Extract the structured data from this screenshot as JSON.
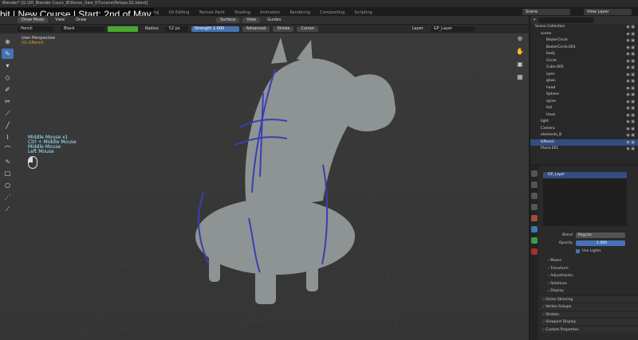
{
  "window": {
    "title": "Blender* [G:\\00_Blender Cours_IE\\Horse_Uwe_07\\scene\\Pelopo.02.blend]",
    "overlay_title": "bit | New Course | Start: 2nd of May"
  },
  "workspace_tabs": [
    "Sculpting",
    "UV Editing",
    "Texture Paint",
    "Shading",
    "Animation",
    "Rendering",
    "Compositing",
    "Scripting"
  ],
  "scene": {
    "name": "Scene",
    "view_layer": "View Layer"
  },
  "header": {
    "mode": "Draw Mode",
    "menus": [
      "View",
      "Draw"
    ],
    "placement": "Surface",
    "view_btn": "View",
    "guides": "Guides"
  },
  "tool_settings": {
    "brush": "Pencil",
    "material": "Black",
    "color_hex": "#4aa832",
    "radius_label": "Radius",
    "radius_value": "52 px",
    "strength_label": "Strength",
    "strength_value": "1.000",
    "advanced": "Advanced",
    "stroke": "Stroke",
    "cursor": "Cursor",
    "layer_label": "Layer",
    "layer_value": "GP_Layer"
  },
  "viewport": {
    "perspective": "User Perspective",
    "object_info": "(0) GPencil",
    "mouse_hints": [
      "Middle Mouse x1",
      "Ctrl + Middle Mouse",
      "Middle Mouse",
      "Left Mouse"
    ]
  },
  "toolbar_icons": [
    "cursor-icon",
    "pencil-icon",
    "fill-icon",
    "erase-icon",
    "tint-icon",
    "cutter-icon",
    "eyedropper-icon",
    "line-icon",
    "polyline-icon",
    "arc-icon",
    "curve-icon",
    "box-icon",
    "circle-icon",
    "interpolate-icon",
    "measure-icon"
  ],
  "outliner": {
    "title": "Scene Collection",
    "rows": [
      {
        "name": "Scene Collection",
        "indent": 0,
        "selected": false
      },
      {
        "name": "scene",
        "indent": 1,
        "selected": false
      },
      {
        "name": "BezierCircle",
        "indent": 2,
        "selected": false
      },
      {
        "name": "BezierCircle.001",
        "indent": 2,
        "selected": false
      },
      {
        "name": "body",
        "indent": 2,
        "selected": false
      },
      {
        "name": "Circle",
        "indent": 2,
        "selected": false
      },
      {
        "name": "Cube.005",
        "indent": 2,
        "selected": false
      },
      {
        "name": "eyes",
        "indent": 2,
        "selected": false
      },
      {
        "name": "glass",
        "indent": 2,
        "selected": false
      },
      {
        "name": "head",
        "indent": 2,
        "selected": false
      },
      {
        "name": "Sphere",
        "indent": 2,
        "selected": false
      },
      {
        "name": "spine",
        "indent": 2,
        "selected": false
      },
      {
        "name": "tail",
        "indent": 2,
        "selected": false
      },
      {
        "name": "trees",
        "indent": 2,
        "selected": false
      },
      {
        "name": "light",
        "indent": 1,
        "selected": false
      },
      {
        "name": "Camera",
        "indent": 1,
        "selected": false
      },
      {
        "name": "elements_B",
        "indent": 1,
        "selected": false
      },
      {
        "name": "GPencil",
        "indent": 1,
        "selected": true
      },
      {
        "name": "Plane.001",
        "indent": 1,
        "selected": false
      }
    ]
  },
  "properties": {
    "layer_name": "GP_Layer",
    "blend_label": "Blend",
    "blend_value": "Regular",
    "opacity_label": "Opacity",
    "opacity_value": "1.000",
    "use_lights": "Use Lights",
    "sub_sections": [
      "Masks",
      "Transform",
      "Adjustments",
      "Relations",
      "Display"
    ],
    "sections": [
      "Onion Skinning",
      "Vertex Groups",
      "Strokes",
      "Viewport Display",
      "Custom Properties"
    ]
  }
}
